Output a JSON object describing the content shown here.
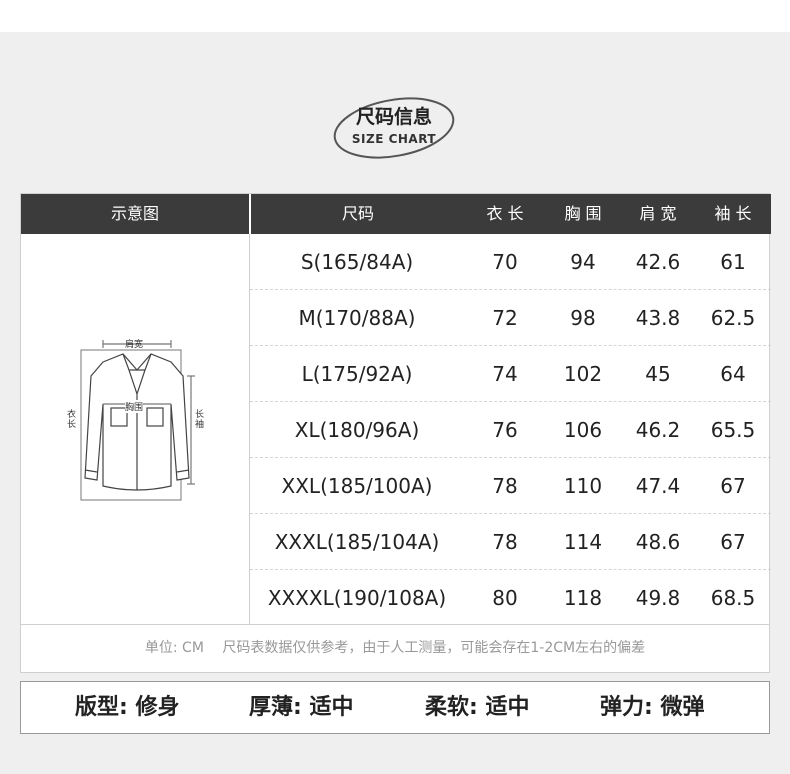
{
  "badge": {
    "title": "尺码信息",
    "subtitle": "SIZE CHART"
  },
  "table": {
    "headers": [
      "示意图",
      "尺码",
      "衣 长",
      "胸 围",
      "肩 宽",
      "袖 长"
    ],
    "rows": [
      [
        "S(165/84A)",
        "70",
        "94",
        "42.6",
        "61"
      ],
      [
        "M(170/88A)",
        "72",
        "98",
        "43.8",
        "62.5"
      ],
      [
        "L(175/92A)",
        "74",
        "102",
        "45",
        "64"
      ],
      [
        "XL(180/96A)",
        "76",
        "106",
        "46.2",
        "65.5"
      ],
      [
        "XXL(185/100A)",
        "78",
        "110",
        "47.4",
        "67"
      ],
      [
        "XXXL(185/104A)",
        "78",
        "114",
        "48.6",
        "67"
      ],
      [
        "XXXXL(190/108A)",
        "80",
        "118",
        "49.8",
        "68.5"
      ]
    ]
  },
  "diagram": {
    "shoulder": "肩宽",
    "chest": "胸围",
    "length": "衣长",
    "sleeve": "长袖"
  },
  "note": "单位: CM　 尺码表数据仅供参考，由于人工测量，可能会存在1-2CM左右的偏差",
  "features": [
    "版型: 修身",
    "厚薄: 适中",
    "柔软: 适中",
    "弹力: 微弹"
  ]
}
